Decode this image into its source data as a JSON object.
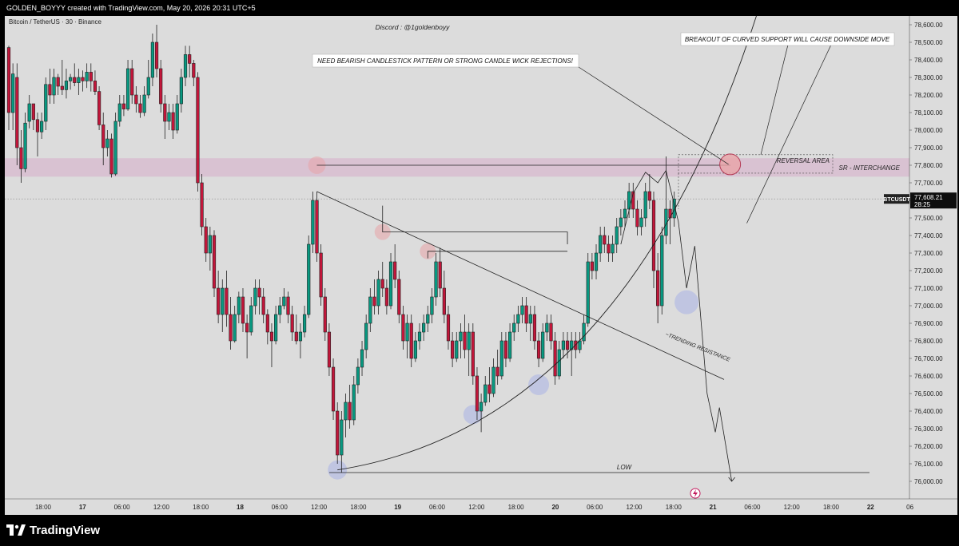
{
  "header": {
    "attribution": "GOLDEN_BOYYY created with TradingView.com, May 20, 2026 20:31 UTC+5"
  },
  "footer": {
    "brand": "TradingView"
  },
  "chart_data": {
    "type": "candlestick",
    "symbol_label": "Bitcoin / TetherUS · 30 · Binance",
    "watermark": "Discord : @1goldenboyy",
    "ylim": [
      75900,
      78650
    ],
    "y_ticks": [
      "78,600.00",
      "78,500.00",
      "78,400.00",
      "78,300.00",
      "78,200.00",
      "78,100.00",
      "78,000.00",
      "77,900.00",
      "77,800.00",
      "77,700.00",
      "77,600.00",
      "77,500.00",
      "77,400.00",
      "77,300.00",
      "77,200.00",
      "77,100.00",
      "77,000.00",
      "76,900.00",
      "76,800.00",
      "76,700.00",
      "76,600.00",
      "76,500.00",
      "76,400.00",
      "76,300.00",
      "76,200.00",
      "76,100.00",
      "76,000.00"
    ],
    "x_ticks": [
      "18:00",
      "17",
      "06:00",
      "12:00",
      "18:00",
      "18",
      "06:00",
      "12:00",
      "18:00",
      "19",
      "06:00",
      "12:00",
      "18:00",
      "20",
      "06:00",
      "12:00",
      "18:00",
      "21",
      "06:00",
      "12:00",
      "18:00",
      "22",
      "06"
    ],
    "bold_x_ticks": [
      "17",
      "18",
      "19",
      "20",
      "21",
      "22"
    ],
    "last_price": {
      "symbol": "BTCUSDT",
      "price": "77,608.21",
      "countdown": "28:25",
      "value": 77608.21
    },
    "zones": [
      {
        "name": "sr-interchange",
        "label": "SR - INTERCHANGE",
        "low": 77735,
        "high": 77840
      }
    ],
    "reversal_area": {
      "label": "REVERSAL AREA",
      "low": 77755,
      "high": 77860
    },
    "annotations": [
      {
        "name": "bearish-pattern-note",
        "text": "NEED  BEARISH CANDLESTICK PATTERN OR STRONG CANDLE WICK REJECTIONS!"
      },
      {
        "name": "breakout-note",
        "text": "BREAKOUT OF CURVED SUPPORT WILL CAUSE DOWNSIDE MOVE"
      },
      {
        "name": "trending-resistance-label",
        "text": "TRENDING RESISTANCE"
      },
      {
        "name": "low-label",
        "text": "LOW"
      }
    ],
    "levels": [
      {
        "name": "low-line",
        "value": 76050
      },
      {
        "name": "sr-top-line",
        "value": 77800
      },
      {
        "name": "upper-box-top",
        "value": 77420
      },
      {
        "name": "upper-box-bottom",
        "value": 77310
      }
    ],
    "trend_resistance": {
      "from": {
        "bar": 75,
        "price": 77650
      },
      "to": {
        "bar": 155,
        "price": 76580
      }
    },
    "projection": [
      {
        "bar": 149,
        "price": 77350
      },
      {
        "bar": 152,
        "price": 77640
      },
      {
        "bar": 155,
        "price": 77760
      },
      {
        "bar": 158,
        "price": 77700
      },
      {
        "bar": 160,
        "price": 77770
      },
      {
        "bar": 163,
        "price": 77480
      },
      {
        "bar": 165,
        "price": 77100
      },
      {
        "bar": 167,
        "price": 77340
      },
      {
        "bar": 170,
        "price": 76500
      },
      {
        "bar": 172,
        "price": 76280
      },
      {
        "bar": 173,
        "price": 76420
      },
      {
        "bar": 176,
        "price": 76000
      }
    ],
    "candles": [
      [
        78470,
        78480,
        78000,
        78100
      ],
      [
        78100,
        78380,
        78000,
        78320
      ],
      [
        78300,
        78380,
        77800,
        77900
      ],
      [
        77900,
        78000,
        77700,
        77780
      ],
      [
        77780,
        78100,
        77760,
        78040
      ],
      [
        78050,
        78200,
        78010,
        78150
      ],
      [
        78150,
        78150,
        78000,
        78060
      ],
      [
        78060,
        78100,
        77850,
        77990
      ],
      [
        77990,
        78100,
        77950,
        78050
      ],
      [
        78050,
        78300,
        78000,
        78260
      ],
      [
        78260,
        78350,
        78150,
        78200
      ],
      [
        78200,
        78350,
        78150,
        78300
      ],
      [
        78300,
        78320,
        78200,
        78250
      ],
      [
        78250,
        78400,
        78200,
        78230
      ],
      [
        78230,
        78350,
        78180,
        78280
      ],
      [
        78280,
        78320,
        78230,
        78300
      ],
      [
        78300,
        78380,
        78250,
        78270
      ],
      [
        78270,
        78350,
        78200,
        78300
      ],
      [
        78300,
        78340,
        78220,
        78280
      ],
      [
        78280,
        78380,
        78240,
        78330
      ],
      [
        78330,
        78380,
        78220,
        78280
      ],
      [
        78280,
        78340,
        78200,
        78220
      ],
      [
        78220,
        78250,
        78000,
        78030
      ],
      [
        78030,
        78100,
        77800,
        77900
      ],
      [
        77900,
        78000,
        77850,
        77950
      ],
      [
        77950,
        77980,
        77730,
        77750
      ],
      [
        77750,
        78100,
        77740,
        78050
      ],
      [
        78050,
        78200,
        78020,
        78150
      ],
      [
        78150,
        78200,
        78080,
        78120
      ],
      [
        78120,
        78400,
        78110,
        78350
      ],
      [
        78350,
        78400,
        78150,
        78200
      ],
      [
        78200,
        78250,
        78100,
        78150
      ],
      [
        78150,
        78200,
        78070,
        78100
      ],
      [
        78100,
        78250,
        78080,
        78200
      ],
      [
        78200,
        78400,
        78180,
        78300
      ],
      [
        78300,
        78550,
        78250,
        78500
      ],
      [
        78500,
        78600,
        78300,
        78350
      ],
      [
        78350,
        78400,
        78100,
        78150
      ],
      [
        78150,
        78200,
        77950,
        78050
      ],
      [
        78050,
        78150,
        78000,
        78100
      ],
      [
        78100,
        78150,
        77950,
        78000
      ],
      [
        78000,
        78200,
        77980,
        78150
      ],
      [
        78150,
        78350,
        78100,
        78300
      ],
      [
        78300,
        78480,
        78250,
        78430
      ],
      [
        78430,
        78480,
        78300,
        78380
      ],
      [
        78380,
        78400,
        78250,
        78300
      ],
      [
        78300,
        78330,
        77650,
        77700
      ],
      [
        77700,
        77750,
        77400,
        77450
      ],
      [
        77450,
        77500,
        77250,
        77300
      ],
      [
        77300,
        77450,
        77200,
        77400
      ],
      [
        77400,
        77430,
        77050,
        77100
      ],
      [
        77100,
        77200,
        76900,
        76950
      ],
      [
        76950,
        77150,
        76850,
        77100
      ],
      [
        77100,
        77200,
        76880,
        76950
      ],
      [
        76950,
        77050,
        76750,
        76800
      ],
      [
        76800,
        77000,
        76790,
        76950
      ],
      [
        76950,
        77080,
        76900,
        77050
      ],
      [
        77050,
        77100,
        76850,
        76900
      ],
      [
        76900,
        76950,
        76700,
        76850
      ],
      [
        76850,
        77050,
        76830,
        77000
      ],
      [
        77000,
        77150,
        76950,
        77100
      ],
      [
        77100,
        77150,
        76950,
        77050
      ],
      [
        77050,
        77100,
        76900,
        76950
      ],
      [
        76950,
        76980,
        76780,
        76850
      ],
      [
        76850,
        76900,
        76650,
        76800
      ],
      [
        76800,
        77000,
        76780,
        76950
      ],
      [
        76950,
        77050,
        76900,
        77000
      ],
      [
        77000,
        77100,
        76980,
        77050
      ],
      [
        77050,
        77080,
        76900,
        76950
      ],
      [
        76950,
        77000,
        76800,
        76850
      ],
      [
        76850,
        76950,
        76780,
        76800
      ],
      [
        76800,
        76900,
        76700,
        76850
      ],
      [
        76850,
        77000,
        76820,
        76950
      ],
      [
        76950,
        77400,
        76930,
        77350
      ],
      [
        77350,
        77650,
        77300,
        77600
      ],
      [
        77600,
        77650,
        77250,
        77300
      ],
      [
        77300,
        77350,
        77000,
        77050
      ],
      [
        77050,
        77100,
        76800,
        76850
      ],
      [
        76850,
        76900,
        76600,
        76650
      ],
      [
        76650,
        76700,
        76350,
        76400
      ],
      [
        76400,
        76450,
        76100,
        76150
      ],
      [
        76150,
        76400,
        76050,
        76350
      ],
      [
        76350,
        76500,
        76250,
        76450
      ],
      [
        76450,
        76550,
        76300,
        76350
      ],
      [
        76350,
        76600,
        76320,
        76550
      ],
      [
        76550,
        76700,
        76500,
        76650
      ],
      [
        76650,
        76800,
        76600,
        76750
      ],
      [
        76750,
        76950,
        76700,
        76900
      ],
      [
        76900,
        77100,
        76850,
        77050
      ],
      [
        77050,
        77150,
        76950,
        77000
      ],
      [
        77000,
        77200,
        76950,
        77150
      ],
      [
        77150,
        77250,
        77050,
        77100
      ],
      [
        77100,
        77150,
        76950,
        77000
      ],
      [
        77000,
        77300,
        76980,
        77250
      ],
      [
        77250,
        77350,
        77100,
        77150
      ],
      [
        77150,
        77200,
        76900,
        76950
      ],
      [
        76950,
        77000,
        76750,
        76800
      ],
      [
        76800,
        76950,
        76700,
        76900
      ],
      [
        76900,
        76950,
        76650,
        76700
      ],
      [
        76700,
        76850,
        76680,
        76800
      ],
      [
        76800,
        76900,
        76750,
        76850
      ],
      [
        76850,
        76950,
        76800,
        76900
      ],
      [
        76900,
        77000,
        76850,
        76950
      ],
      [
        76950,
        77100,
        76900,
        77050
      ],
      [
        77050,
        77300,
        77000,
        77250
      ],
      [
        77250,
        77330,
        77050,
        77100
      ],
      [
        77100,
        77200,
        76900,
        76950
      ],
      [
        76950,
        77000,
        76750,
        76800
      ],
      [
        76800,
        76850,
        76650,
        76700
      ],
      [
        76700,
        76850,
        76680,
        76800
      ],
      [
        76800,
        76900,
        76700,
        76850
      ],
      [
        76850,
        76950,
        76700,
        76750
      ],
      [
        76750,
        76900,
        76600,
        76850
      ],
      [
        76850,
        76900,
        76550,
        76600
      ],
      [
        76600,
        76650,
        76350,
        76400
      ],
      [
        76400,
        76500,
        76280,
        76450
      ],
      [
        76450,
        76600,
        76430,
        76550
      ],
      [
        76550,
        76650,
        76450,
        76500
      ],
      [
        76500,
        76700,
        76480,
        76650
      ],
      [
        76650,
        76750,
        76550,
        76600
      ],
      [
        76600,
        76850,
        76580,
        76800
      ],
      [
        76800,
        76850,
        76650,
        76700
      ],
      [
        76700,
        76900,
        76680,
        76850
      ],
      [
        76850,
        76950,
        76800,
        76900
      ],
      [
        76900,
        77000,
        76850,
        76950
      ],
      [
        76950,
        77050,
        76900,
        77000
      ],
      [
        77000,
        77050,
        76850,
        76900
      ],
      [
        76900,
        77000,
        76800,
        76950
      ],
      [
        76950,
        77000,
        76750,
        76800
      ],
      [
        76800,
        76850,
        76650,
        76700
      ],
      [
        76700,
        76900,
        76680,
        76850
      ],
      [
        76850,
        76950,
        76800,
        76900
      ],
      [
        76900,
        76950,
        76750,
        76800
      ],
      [
        76800,
        76850,
        76550,
        76600
      ],
      [
        76600,
        76800,
        76580,
        76750
      ],
      [
        76750,
        76850,
        76700,
        76800
      ],
      [
        76800,
        76850,
        76700,
        76750
      ],
      [
        76750,
        76850,
        76600,
        76800
      ],
      [
        76800,
        76850,
        76700,
        76750
      ],
      [
        76750,
        76850,
        76730,
        76800
      ],
      [
        76800,
        76950,
        76780,
        76900
      ],
      [
        76900,
        77300,
        76880,
        77250
      ],
      [
        77250,
        77300,
        77150,
        77200
      ],
      [
        77200,
        77350,
        77150,
        77300
      ],
      [
        77300,
        77450,
        77250,
        77400
      ],
      [
        77400,
        77450,
        77300,
        77350
      ],
      [
        77350,
        77400,
        77250,
        77300
      ],
      [
        77300,
        77400,
        77250,
        77350
      ],
      [
        77350,
        77500,
        77300,
        77450
      ],
      [
        77450,
        77550,
        77400,
        77500
      ],
      [
        77500,
        77600,
        77450,
        77550
      ],
      [
        77550,
        77700,
        77500,
        77650
      ],
      [
        77650,
        77700,
        77500,
        77550
      ],
      [
        77550,
        77600,
        77400,
        77450
      ],
      [
        77450,
        77550,
        77400,
        77500
      ],
      [
        77500,
        77700,
        77450,
        77650
      ],
      [
        77650,
        77750,
        77550,
        77600
      ],
      [
        77600,
        77650,
        77100,
        77200
      ],
      [
        77200,
        77300,
        76900,
        77000
      ],
      [
        77000,
        77450,
        76950,
        77400
      ],
      [
        77400,
        77850,
        77350,
        77550
      ],
      [
        77550,
        77600,
        77350,
        77500
      ],
      [
        77500,
        77650,
        77450,
        77608
      ]
    ]
  }
}
